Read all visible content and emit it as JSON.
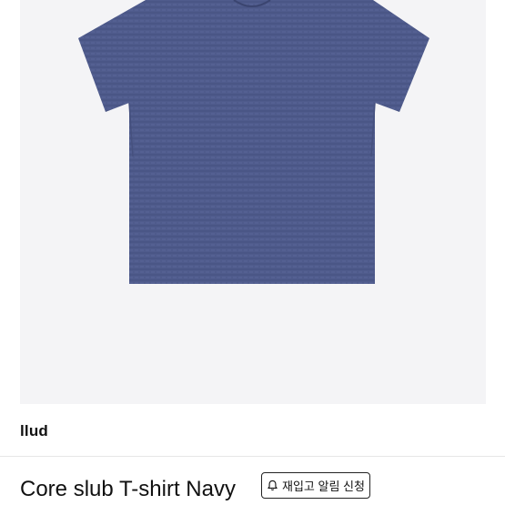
{
  "product": {
    "image_alt": "Navy slub t-shirt",
    "shirt_color": "#4f5b8c",
    "brand": "llud",
    "title": "Core slub T-shirt Navy",
    "restock_label": "재입고 알림 신청"
  }
}
